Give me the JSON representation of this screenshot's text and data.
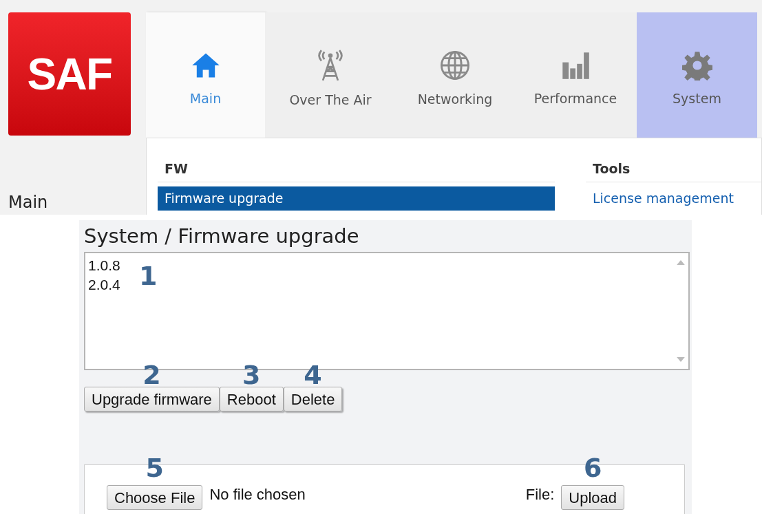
{
  "logo": {
    "text": "SAF"
  },
  "tabs": [
    {
      "label": "Main",
      "current": true,
      "selected": false
    },
    {
      "label": "Over The Air",
      "current": false,
      "selected": false
    },
    {
      "label": "Networking",
      "current": false,
      "selected": false
    },
    {
      "label": "Performance",
      "current": false,
      "selected": false
    },
    {
      "label": "System",
      "current": false,
      "selected": true
    }
  ],
  "sidebar": {
    "title": "Main"
  },
  "menu": {
    "sections": [
      {
        "heading": "FW",
        "items": [
          {
            "label": "Firmware upgrade",
            "selected": true
          }
        ]
      },
      {
        "heading": "Tools",
        "items": [
          {
            "label": "License management",
            "selected": false
          }
        ]
      }
    ]
  },
  "page": {
    "title": "System / Firmware upgrade",
    "listbox": {
      "items": [
        "1.0.8",
        "2.0.4"
      ],
      "marker": "1"
    },
    "buttons": [
      {
        "label": "Upgrade firmware",
        "marker": "2"
      },
      {
        "label": "Reboot",
        "marker": "3"
      },
      {
        "label": "Delete",
        "marker": "4"
      }
    ],
    "upload": {
      "choose": {
        "label": "Choose File",
        "marker": "5"
      },
      "status": "No file chosen",
      "file_label": "File:",
      "upload": {
        "label": "Upload",
        "marker": "6"
      }
    }
  }
}
